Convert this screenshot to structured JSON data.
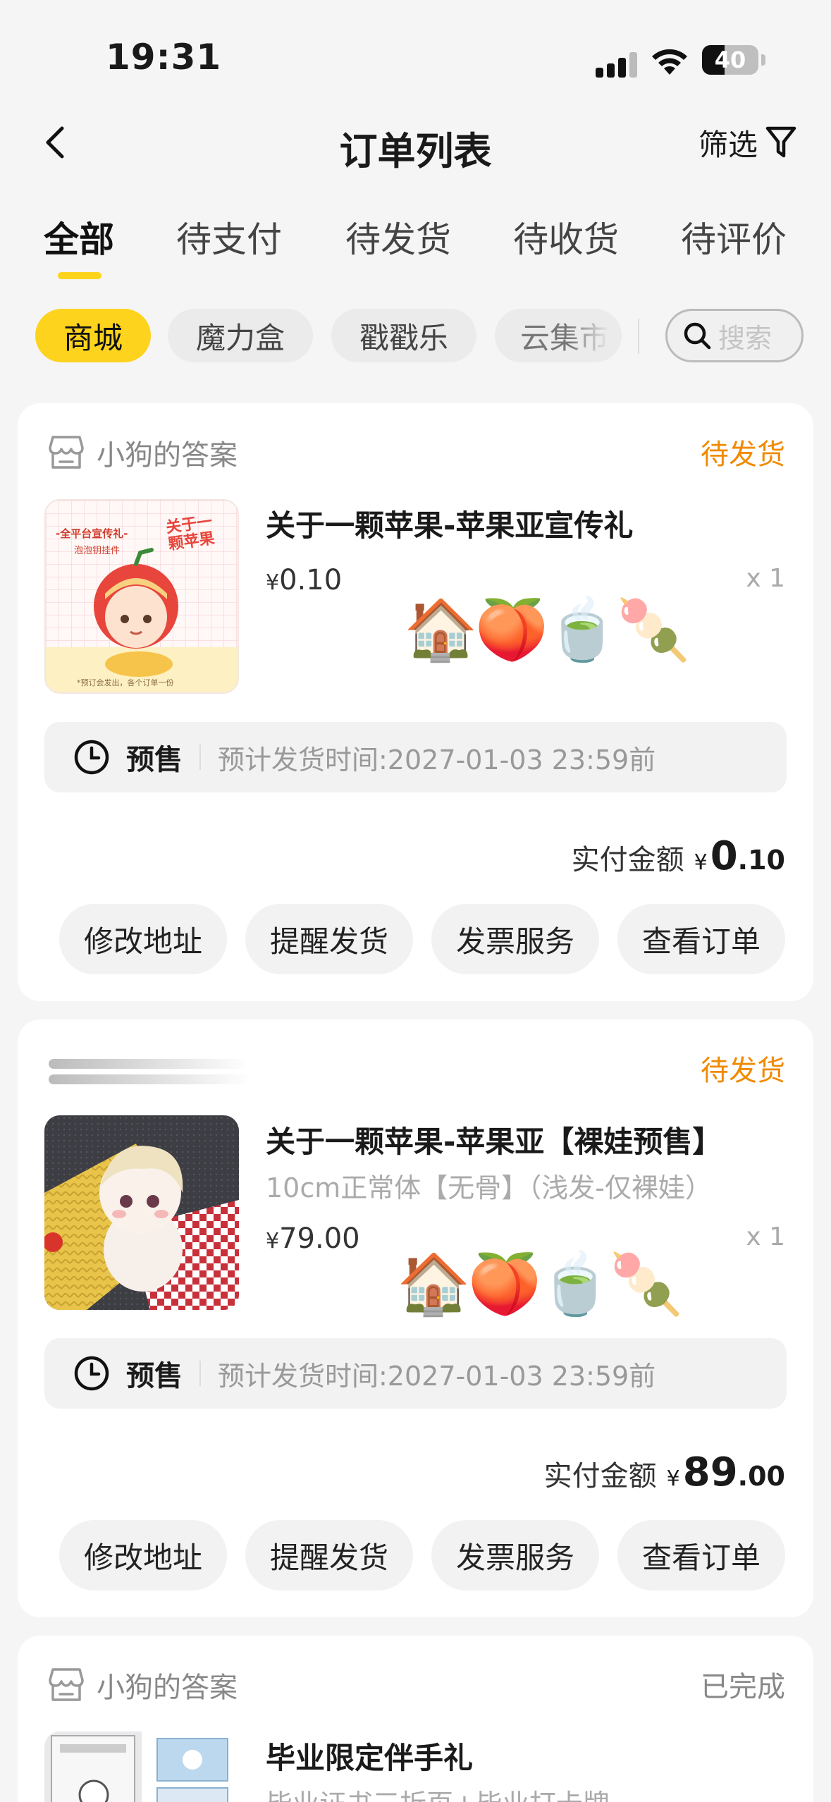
{
  "status_bar": {
    "time": "19:31",
    "battery": "40"
  },
  "nav": {
    "title": "订单列表",
    "filter_label": "筛选"
  },
  "tabs": [
    "全部",
    "待支付",
    "待发货",
    "待收货",
    "待评价"
  ],
  "chips": [
    "商城",
    "魔力盒",
    "戳戳乐",
    "云集市"
  ],
  "search": {
    "placeholder": "搜索"
  },
  "colors": {
    "accent": "#fdd31d",
    "status_orange": "#f08a00"
  },
  "orders": [
    {
      "shop": "小狗的答案",
      "status": "待发货",
      "title": "关于一颗苹果-苹果亚宣传礼",
      "price_yen": "¥",
      "price": "0.10",
      "qty": "x 1",
      "emojis": "🏠🍑🍵🍡",
      "presale_label": "预售",
      "presale_date": "预计发货时间:2027-01-03 23:59前",
      "total_label": "实付金额",
      "total_yen": "¥",
      "total_int": "0",
      "total_dec": ".10",
      "actions": [
        "修改地址",
        "提醒发货",
        "发票服务",
        "查看订单"
      ],
      "thumb_text": [
        "-全平台宣传礼-",
        "泡泡钥挂件",
        "关于一颗苹果",
        "*预订会发出，各个订单一份"
      ]
    },
    {
      "shop": "",
      "status": "待发货",
      "title": "关于一颗苹果-苹果亚【裸娃预售】",
      "subtitle": "10cm正常体【无骨】（浅发-仅裸娃）",
      "price_yen": "¥",
      "price": "79.00",
      "qty": "x 1",
      "emojis": "🏠🍑🍵🍡",
      "presale_label": "预售",
      "presale_date": "预计发货时间:2027-01-03 23:59前",
      "total_label": "实付金额",
      "total_yen": "¥",
      "total_int": "89",
      "total_dec": ".00",
      "actions": [
        "修改地址",
        "提醒发货",
        "发票服务",
        "查看订单"
      ]
    },
    {
      "shop": "小狗的答案",
      "status": "已完成",
      "title": "毕业限定伴手礼",
      "subtitle": "毕业证书三折页+毕业打卡牌"
    }
  ]
}
